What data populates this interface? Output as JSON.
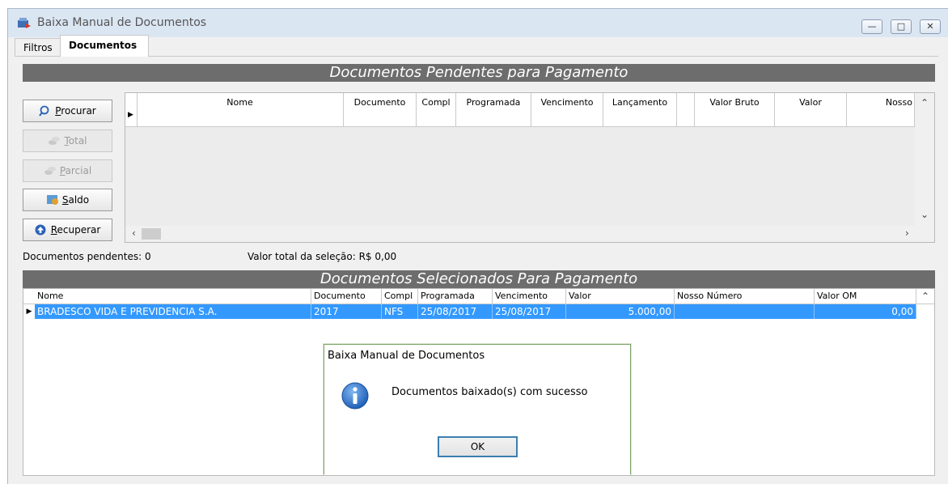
{
  "window": {
    "title": "Baixa Manual de Documentos",
    "buttons": {
      "minimize": "—",
      "maximize": "□",
      "close": "✕"
    }
  },
  "tabs": [
    {
      "label": "Filtros"
    },
    {
      "label": "Documentos",
      "active": true
    }
  ],
  "pending": {
    "header": "Documentos Pendentes para Pagamento",
    "buttons": {
      "search": {
        "icon": "search-icon",
        "mnemonic": "P",
        "rest": "rocurar"
      },
      "total": {
        "icon": "coins-icon",
        "mnemonic": "T",
        "rest": "otal"
      },
      "partial": {
        "icon": "coins-icon",
        "mnemonic": "P",
        "rest": "arcial"
      },
      "balance": {
        "icon": "balance-icon",
        "mnemonic": "S",
        "rest": "aldo"
      },
      "recover": {
        "icon": "up-arrow-icon",
        "mnemonic": "R",
        "rest": "ecuperar"
      }
    },
    "columns": [
      "Nome",
      "Documento",
      "Compl",
      "Programada",
      "Vencimento",
      "Lançamento",
      "",
      "Valor Bruto",
      "Valor",
      "Nosso"
    ]
  },
  "status": {
    "pending_count": "Documentos pendentes: 0",
    "selection_total": "Valor total da seleção: R$ 0,00"
  },
  "selected": {
    "header": "Documentos Selecionados Para Pagamento",
    "columns": [
      "Nome",
      "Documento",
      "Compl",
      "Programada",
      "Vencimento",
      "Valor",
      "Nosso Número",
      "Valor OM"
    ],
    "rows": [
      {
        "nome": "BRADESCO VIDA E PREVIDENCIA S.A.",
        "documento": "2017",
        "compl": "NFS",
        "programada": "25/08/2017",
        "vencimento": "25/08/2017",
        "valor": "5.000,00",
        "nosso_numero": "",
        "valor_om": "0,00"
      }
    ]
  },
  "dialog": {
    "title": "Baixa Manual de Documentos",
    "message": "Documentos baixado(s) com sucesso",
    "ok_label": "OK",
    "icon": "info-icon"
  },
  "colors": {
    "selection": "#3399ff",
    "section_header": "#6d6d6d",
    "titlebar": "#dbe6f3"
  }
}
